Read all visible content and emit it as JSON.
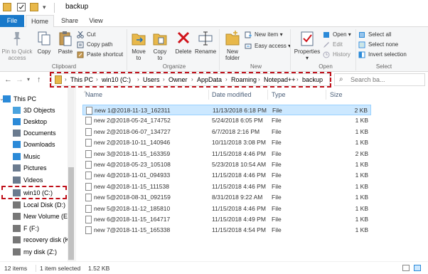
{
  "window": {
    "title": "backup"
  },
  "tabs": [
    "File",
    "Home",
    "Share",
    "View"
  ],
  "ribbon": {
    "clipboard": {
      "label": "Clipboard",
      "pin": "Pin to Quick\naccess",
      "copy": "Copy",
      "paste": "Paste",
      "cut": "Cut",
      "copy_path": "Copy path",
      "paste_shortcut": "Paste shortcut"
    },
    "organize": {
      "label": "Organize",
      "move_to": "Move\nto",
      "copy_to": "Copy\nto",
      "delete": "Delete",
      "rename": "Rename"
    },
    "new": {
      "label": "New",
      "new_folder": "New\nfolder",
      "new_item": "New item",
      "easy_access": "Easy access"
    },
    "open": {
      "label": "Open",
      "properties": "Properties",
      "open": "Open",
      "edit": "Edit",
      "history": "History"
    },
    "select": {
      "label": "Select",
      "select_all": "Select all",
      "select_none": "Select none",
      "invert": "Invert selection"
    }
  },
  "address": {
    "crumbs": [
      "This PC",
      "win10 (C:)",
      "Users",
      "Owner",
      "AppData",
      "Roaming",
      "Notepad++",
      "backup"
    ],
    "search_placeholder": "Search ba..."
  },
  "nav": [
    {
      "label": "This PC",
      "icon": "pc-icon",
      "color": "#2b8ad8"
    },
    {
      "label": "3D Objects",
      "icon": "cube-icon",
      "color": "#4aa3df"
    },
    {
      "label": "Desktop",
      "icon": "desktop-icon",
      "color": "#2b8ad8"
    },
    {
      "label": "Documents",
      "icon": "documents-icon",
      "color": "#6b7b8f"
    },
    {
      "label": "Downloads",
      "icon": "download-icon",
      "color": "#2b8ad8"
    },
    {
      "label": "Music",
      "icon": "music-icon",
      "color": "#2b8ad8"
    },
    {
      "label": "Pictures",
      "icon": "pictures-icon",
      "color": "#6b7b8f"
    },
    {
      "label": "Videos",
      "icon": "videos-icon",
      "color": "#6b7b8f"
    },
    {
      "label": "win10 (C:)",
      "icon": "drive-windows-icon",
      "color": "#6b7b8f"
    },
    {
      "label": "Local Disk (D:)",
      "icon": "drive-icon",
      "color": "#777"
    },
    {
      "label": "New Volume (E:)",
      "icon": "drive-icon",
      "color": "#777"
    },
    {
      "label": "F (F:)",
      "icon": "drive-icon",
      "color": "#777"
    },
    {
      "label": "recovery disk (K:",
      "icon": "drive-icon",
      "color": "#777"
    },
    {
      "label": "my disk (Z:)",
      "icon": "drive-icon",
      "color": "#777"
    }
  ],
  "columns": [
    "Name",
    "Date modified",
    "Type",
    "Size"
  ],
  "files": [
    {
      "name": "new 1@2018-11-13_162311",
      "date": "11/13/2018 6:18 PM",
      "type": "File",
      "size": "2 KB",
      "selected": true
    },
    {
      "name": "new 2@2018-05-24_174752",
      "date": "5/24/2018 6:05 PM",
      "type": "File",
      "size": "1 KB"
    },
    {
      "name": "new 2@2018-06-07_134727",
      "date": "6/7/2018 2:16 PM",
      "type": "File",
      "size": "1 KB"
    },
    {
      "name": "new 2@2018-10-11_140946",
      "date": "10/11/2018 3:08 PM",
      "type": "File",
      "size": "1 KB"
    },
    {
      "name": "new 3@2018-11-15_163359",
      "date": "11/15/2018 4:46 PM",
      "type": "File",
      "size": "2 KB"
    },
    {
      "name": "new 4@2018-05-23_105108",
      "date": "5/23/2018 10:54 AM",
      "type": "File",
      "size": "1 KB"
    },
    {
      "name": "new 4@2018-11-01_094933",
      "date": "11/15/2018 4:46 PM",
      "type": "File",
      "size": "1 KB"
    },
    {
      "name": "new 4@2018-11-15_111538",
      "date": "11/15/2018 4:46 PM",
      "type": "File",
      "size": "1 KB"
    },
    {
      "name": "new 5@2018-08-31_092159",
      "date": "8/31/2018 9:22 AM",
      "type": "File",
      "size": "1 KB"
    },
    {
      "name": "new 5@2018-11-12_185810",
      "date": "11/15/2018 4:46 PM",
      "type": "File",
      "size": "1 KB"
    },
    {
      "name": "new 6@2018-11-15_164717",
      "date": "11/15/2018 4:49 PM",
      "type": "File",
      "size": "1 KB"
    },
    {
      "name": "new 7@2018-11-15_165338",
      "date": "11/15/2018 4:54 PM",
      "type": "File",
      "size": "1 KB"
    }
  ],
  "status": {
    "count": "12 items",
    "selected": "1 item selected",
    "size": "1.52 KB"
  },
  "colors": {
    "accent": "#1979ca",
    "highlight": "#c0101a",
    "selection": "#cce8ff"
  }
}
